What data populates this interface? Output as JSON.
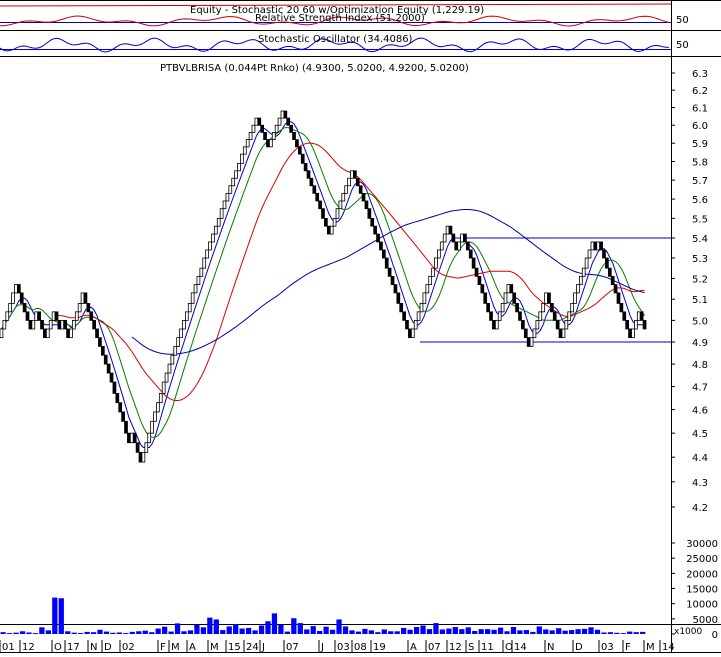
{
  "panels": {
    "equity": {
      "title": "Equity - Stochastic 20 60 w/Optimization Equity (1,229.19)",
      "tick": "50"
    },
    "rsi": {
      "title": "Relative Strength Index (51.2000)",
      "tick": "50"
    },
    "stoch": {
      "title": "Stochastic Oscillator (34.4086)",
      "tick": "50"
    },
    "price": {
      "title": "PTBVLBRISA (0.044Pt Rnko) (4.9300, 5.0200, 4.9200, 5.0200)"
    }
  },
  "colors": {
    "bricks": "#000000",
    "ma_fast": "#0000cc",
    "ma_mid": "#008000",
    "ma_slow": "#dd0000",
    "ma_long": "#0000aa",
    "trendline": "#0000cc",
    "volume": "#0000ff",
    "equity": "#cc0000",
    "rsi": "#cc0000",
    "stoch": "#0000cc"
  },
  "chart_data": {
    "type": "line",
    "price_axis": {
      "ticks": [
        "6.3",
        "6.2",
        "6.1",
        "6.0",
        "5.9",
        "5.8",
        "5.7",
        "5.6",
        "5.5",
        "5.4",
        "5.3",
        "5.2",
        "5.1",
        "5.0",
        "4.9",
        "4.8",
        "4.7",
        "4.6",
        "4.5",
        "4.4",
        "4.3",
        "4.2"
      ],
      "ylim": [
        4.15,
        6.35
      ],
      "scale": "log"
    },
    "volume_axis": {
      "ticks": [
        "30000",
        "25000",
        "20000",
        "15000",
        "10000",
        "5000",
        "0"
      ],
      "multiplier": "x1000",
      "ylim": [
        0,
        30000
      ]
    },
    "x_tick_labels": [
      "01",
      "12",
      "O",
      "17",
      "N",
      "D",
      "02",
      "F",
      "M",
      "A",
      "M",
      "15",
      "24",
      "J",
      "07",
      "J",
      "03",
      "08",
      "19",
      "A",
      "07",
      "12",
      "S",
      "11",
      "O",
      "14",
      "N",
      "D",
      "03",
      "F",
      "M",
      "14"
    ],
    "bricks_close": [
      4.96,
      5.0,
      5.04,
      5.08,
      5.13,
      5.17,
      5.13,
      5.08,
      5.04,
      5.0,
      4.96,
      5.0,
      5.04,
      5.0,
      4.96,
      4.92,
      4.96,
      5.0,
      5.04,
      5.0,
      4.96,
      5.0,
      4.96,
      4.92,
      4.96,
      5.0,
      5.04,
      5.08,
      5.13,
      5.08,
      5.04,
      5.0,
      4.96,
      4.92,
      4.88,
      4.84,
      4.8,
      4.76,
      4.72,
      4.67,
      4.63,
      4.59,
      4.55,
      4.5,
      4.46,
      4.5,
      4.46,
      4.42,
      4.38,
      4.42,
      4.46,
      4.5,
      4.55,
      4.59,
      4.63,
      4.67,
      4.72,
      4.76,
      4.8,
      4.84,
      4.88,
      4.92,
      4.96,
      5.0,
      5.04,
      5.08,
      5.13,
      5.17,
      5.21,
      5.25,
      5.3,
      5.34,
      5.38,
      5.42,
      5.46,
      5.5,
      5.55,
      5.59,
      5.63,
      5.67,
      5.71,
      5.75,
      5.79,
      5.84,
      5.88,
      5.92,
      5.96,
      6.0,
      6.04,
      6.0,
      5.96,
      5.92,
      5.88,
      5.92,
      5.96,
      6.0,
      6.04,
      6.08,
      6.04,
      6.0,
      5.96,
      5.92,
      5.88,
      5.84,
      5.79,
      5.75,
      5.71,
      5.67,
      5.63,
      5.59,
      5.55,
      5.5,
      5.46,
      5.42,
      5.46,
      5.5,
      5.55,
      5.59,
      5.63,
      5.67,
      5.71,
      5.75,
      5.71,
      5.67,
      5.63,
      5.59,
      5.55,
      5.5,
      5.46,
      5.42,
      5.38,
      5.34,
      5.3,
      5.25,
      5.21,
      5.17,
      5.13,
      5.08,
      5.04,
      5.0,
      4.96,
      4.92,
      4.96,
      5.0,
      5.04,
      5.08,
      5.13,
      5.17,
      5.21,
      5.25,
      5.3,
      5.34,
      5.38,
      5.42,
      5.46,
      5.42,
      5.38,
      5.34,
      5.38,
      5.42,
      5.38,
      5.34,
      5.3,
      5.25,
      5.21,
      5.17,
      5.13,
      5.08,
      5.04,
      5.0,
      4.96,
      5.0,
      5.04,
      5.08,
      5.13,
      5.17,
      5.13,
      5.08,
      5.04,
      5.0,
      4.96,
      4.92,
      4.88,
      4.92,
      4.96,
      5.0,
      5.04,
      5.08,
      5.13,
      5.08,
      5.04,
      5.0,
      4.96,
      4.92,
      4.96,
      5.0,
      5.04,
      5.08,
      5.13,
      5.17,
      5.21,
      5.25,
      5.3,
      5.34,
      5.38,
      5.34,
      5.38,
      5.34,
      5.3,
      5.25,
      5.21,
      5.17,
      5.13,
      5.08,
      5.04,
      5.0,
      4.96,
      4.92,
      4.96,
      5.0,
      5.04,
      5.0,
      4.96
    ],
    "bands": {
      "resistance": 5.4,
      "support": 4.9
    },
    "volume_bars": [
      600,
      300,
      450,
      900,
      500,
      300,
      2200,
      1200,
      12000,
      11800,
      900,
      450,
      300,
      700,
      600,
      1400,
      800,
      400,
      500,
      300,
      700,
      900,
      1100,
      600,
      1800,
      2400,
      800,
      3500,
      900,
      1200,
      3000,
      2200,
      5400,
      4800,
      1300,
      2500,
      3300,
      1800,
      2000,
      1200,
      2800,
      4200,
      6800,
      3000,
      800,
      5200,
      3600,
      1500,
      2600,
      1000,
      2400,
      1400,
      4800,
      2500,
      1200,
      800,
      1700,
      1200,
      600,
      1500,
      900,
      900,
      2000,
      1400,
      2300,
      2800,
      1600,
      3600,
      1500,
      1800,
      2300,
      1600,
      2200,
      1000,
      1600,
      1600,
      1400,
      2100,
      900,
      2300,
      1200,
      1300,
      700,
      2500,
      1500,
      1200,
      1900,
      1100,
      1300,
      1600,
      1700,
      2200,
      1400,
      500,
      600,
      400,
      300,
      800,
      600,
      700
    ]
  }
}
